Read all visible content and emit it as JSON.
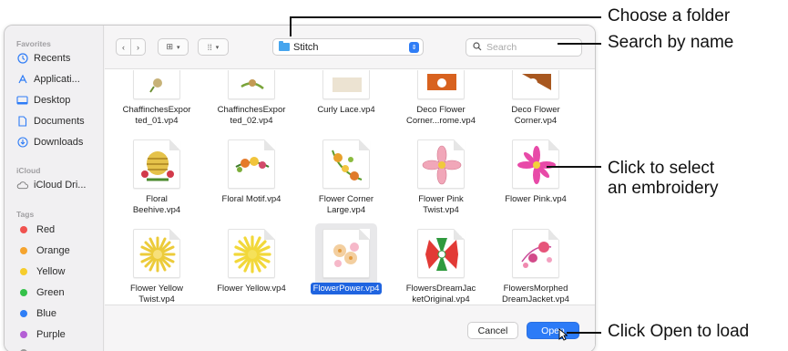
{
  "sidebar": {
    "favorites_title": "Favorites",
    "favorites": [
      {
        "label": "Recents",
        "icon": "clock-icon"
      },
      {
        "label": "Applicati...",
        "icon": "applications-icon"
      },
      {
        "label": "Desktop",
        "icon": "desktop-icon"
      },
      {
        "label": "Documents",
        "icon": "document-icon"
      },
      {
        "label": "Downloads",
        "icon": "download-icon"
      }
    ],
    "icloud_title": "iCloud",
    "icloud": [
      {
        "label": "iCloud Dri...",
        "icon": "cloud-icon"
      }
    ],
    "tags_title": "Tags",
    "tags": [
      {
        "label": "Red",
        "color": "#f0524f"
      },
      {
        "label": "Orange",
        "color": "#f5a42f"
      },
      {
        "label": "Yellow",
        "color": "#f6cd2d"
      },
      {
        "label": "Green",
        "color": "#35c14a"
      },
      {
        "label": "Blue",
        "color": "#2f7ef6"
      },
      {
        "label": "Purple",
        "color": "#b45fd5"
      }
    ]
  },
  "toolbar": {
    "back_icon": "‹",
    "forward_icon": "›",
    "view_icon": "⊞",
    "group_icon": "⁞⁞",
    "folder_name": "Stitch",
    "search_placeholder": "Search"
  },
  "files": [
    {
      "name": "ChaffinchesExpor ted_01.vp4",
      "lines": [
        "ChaffinchesExpor",
        "ted_01.vp4"
      ]
    },
    {
      "name": "ChaffinchesExpor ted_02.vp4",
      "lines": [
        "ChaffinchesExpor",
        "ted_02.vp4"
      ]
    },
    {
      "name": "Curly Lace.vp4",
      "lines": [
        "Curly Lace.vp4"
      ]
    },
    {
      "name": "Deco Flower Corner...rome.vp4",
      "lines": [
        "Deco Flower",
        "Corner...rome.vp4"
      ]
    },
    {
      "name": "Deco Flower Corner.vp4",
      "lines": [
        "Deco Flower",
        "Corner.vp4"
      ]
    },
    {
      "name": "Floral Beehive.vp4",
      "lines": [
        "Floral",
        "Beehive.vp4"
      ]
    },
    {
      "name": "Floral Motif.vp4",
      "lines": [
        "Floral Motif.vp4"
      ]
    },
    {
      "name": "Flower Corner Large.vp4",
      "lines": [
        "Flower Corner",
        "Large.vp4"
      ]
    },
    {
      "name": "Flower Pink Twist.vp4",
      "lines": [
        "Flower Pink",
        "Twist.vp4"
      ]
    },
    {
      "name": "Flower Pink.vp4",
      "lines": [
        "Flower Pink.vp4"
      ]
    },
    {
      "name": "Flower Yellow Twist.vp4",
      "lines": [
        "Flower Yellow",
        "Twist.vp4"
      ]
    },
    {
      "name": "Flower Yellow.vp4",
      "lines": [
        "Flower Yellow.vp4"
      ]
    },
    {
      "name": "FlowerPower.vp4",
      "lines": [
        "FlowerPower.vp4"
      ],
      "selected": true
    },
    {
      "name": "FlowersDreamJac ketOriginal.vp4",
      "lines": [
        "FlowersDreamJac",
        "ketOriginal.vp4"
      ]
    },
    {
      "name": "FlowersMorphed DreamJacket.vp4",
      "lines": [
        "FlowersMorphed",
        "DreamJacket.vp4"
      ]
    }
  ],
  "footer": {
    "cancel_label": "Cancel",
    "open_label": "Open"
  },
  "callouts": {
    "folder": "Choose a folder",
    "search": "Search by name",
    "select_line1": "Click to select",
    "select_line2": "an embroidery",
    "open": "Click Open to load"
  },
  "colors": {
    "accent": "#2c7bf7",
    "selection": "#1f64e0"
  }
}
